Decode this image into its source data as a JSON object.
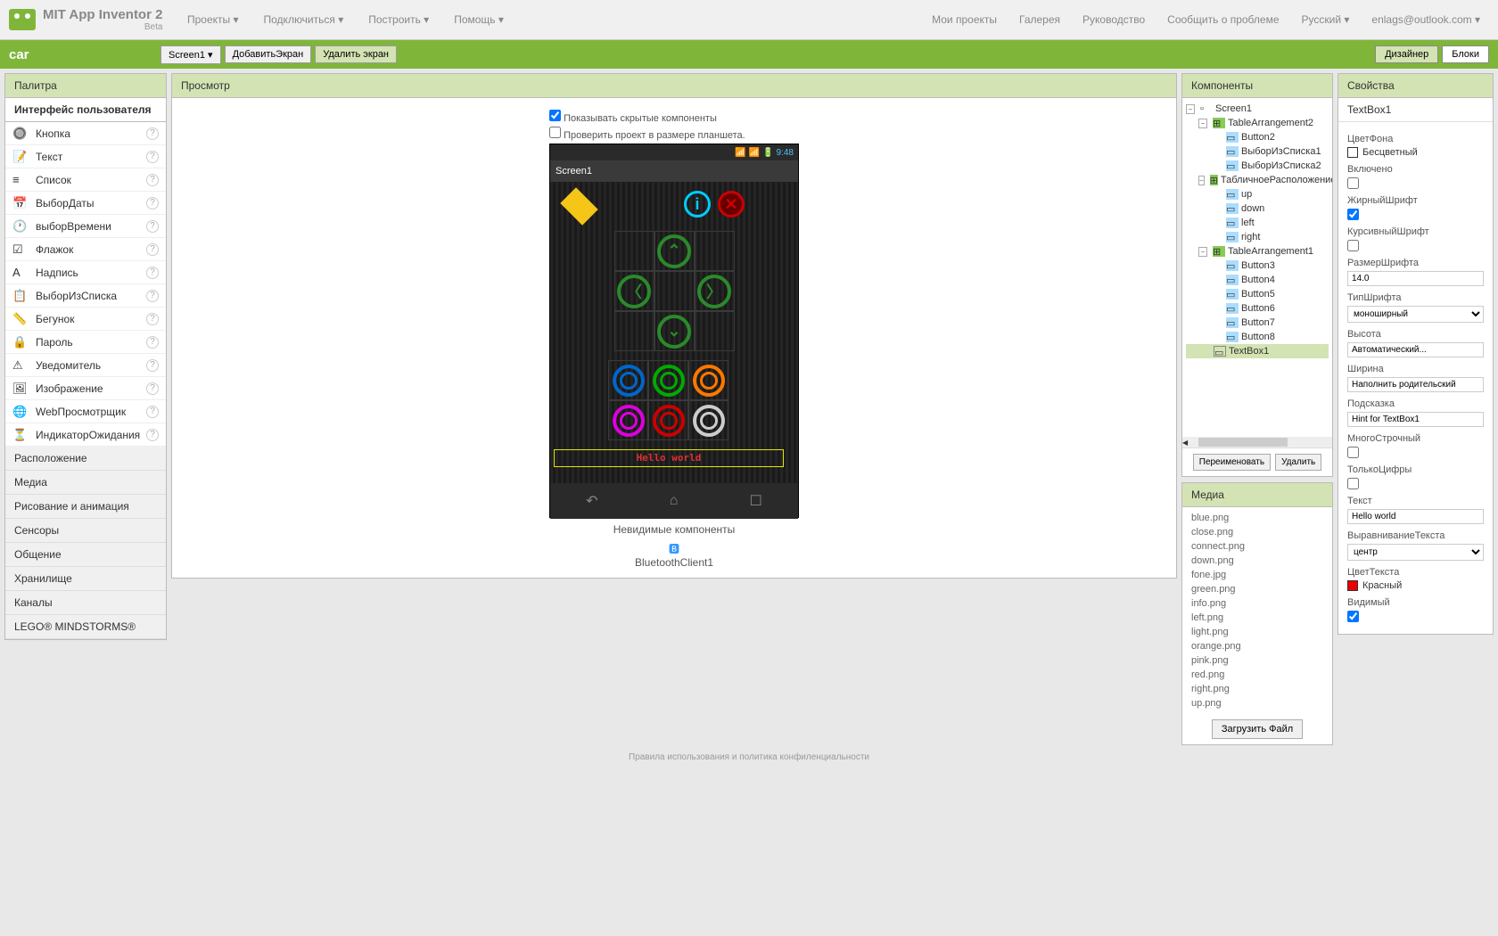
{
  "header": {
    "app_name": "MIT App Inventor 2",
    "beta": "Beta",
    "menus": [
      "Проекты ▾",
      "Подключиться ▾",
      "Построить ▾",
      "Помощь ▾"
    ],
    "right_menus": [
      "Мои проекты",
      "Галерея",
      "Руководство",
      "Сообщить о проблеме",
      "Русский ▾",
      "enlags@outlook.com ▾"
    ]
  },
  "greenbar": {
    "project": "car",
    "screen_btn": "Screen1 ▾",
    "add_screen": "ДобавитьЭкран",
    "del_screen": "Удалить экран",
    "designer": "Дизайнер",
    "blocks": "Блоки"
  },
  "palette": {
    "title": "Палитра",
    "active_category": "Интерфейс пользователя",
    "items": [
      "Кнопка",
      "Текст",
      "Список",
      "ВыборДаты",
      "выборВремени",
      "Флажок",
      "Надпись",
      "ВыборИзСписка",
      "Бегунок",
      "Пароль",
      "Уведомитель",
      "Изображение",
      "WebПросмотрщик",
      "ИндикаторОжидания"
    ],
    "categories": [
      "Расположение",
      "Медиа",
      "Рисование и анимация",
      "Сенсоры",
      "Общение",
      "Хранилище",
      "Каналы",
      "LEGO® MINDSTORMS®"
    ]
  },
  "viewer": {
    "title": "Просмотр",
    "show_hidden": "Показывать скрытые компоненты",
    "tablet_check": "Проверить проект в размере планшета.",
    "time": "9:48",
    "screen_title": "Screen1",
    "hello_text": "Hello world",
    "invisible_title": "Невидимые компоненты",
    "invisible_component": "BluetoothClient1"
  },
  "components": {
    "title": "Компоненты",
    "tree": {
      "root": "Screen1",
      "n1": "TableArrangement2",
      "n1c": [
        "Button2",
        "ВыборИзСписка1",
        "ВыборИзСписка2"
      ],
      "n2": "ТабличноеРасположение",
      "n2c": [
        "up",
        "down",
        "left",
        "right"
      ],
      "n3": "TableArrangement1",
      "n3c": [
        "Button3",
        "Button4",
        "Button5",
        "Button6",
        "Button7",
        "Button8"
      ],
      "selected": "TextBox1"
    },
    "rename": "Переименовать",
    "delete": "Удалить"
  },
  "media": {
    "title": "Медиа",
    "files": [
      "blue.png",
      "close.png",
      "connect.png",
      "down.png",
      "fone.jpg",
      "green.png",
      "info.png",
      "left.png",
      "light.png",
      "orange.png",
      "pink.png",
      "red.png",
      "right.png",
      "up.png"
    ],
    "upload": "Загрузить Файл"
  },
  "properties": {
    "title": "Свойства",
    "component": "TextBox1",
    "bg_color_label": "ЦветФона",
    "bg_color_value": "Бесцветный",
    "enabled": "Включено",
    "bold": "ЖирныйШрифт",
    "italic": "КурсивныйШрифт",
    "font_size": "РазмерШрифта",
    "font_size_val": "14.0",
    "font_type": "ТипШрифта",
    "font_type_val": "моноширный",
    "height": "Высота",
    "height_val": "Автоматический...",
    "width": "Ширина",
    "width_val": "Наполнить родительский",
    "hint": "Подсказка",
    "hint_val": "Hint for TextBox1",
    "multiline": "МногоСтрочный",
    "numbers_only": "ТолькоЦифры",
    "text": "Текст",
    "text_val": "Hello world",
    "text_align": "ВыравниваниеТекста",
    "text_align_val": "центр",
    "text_color": "ЦветТекста",
    "text_color_val": "Красный",
    "visible": "Видимый"
  },
  "footer": "Правила использования и политика конфиленциальности"
}
